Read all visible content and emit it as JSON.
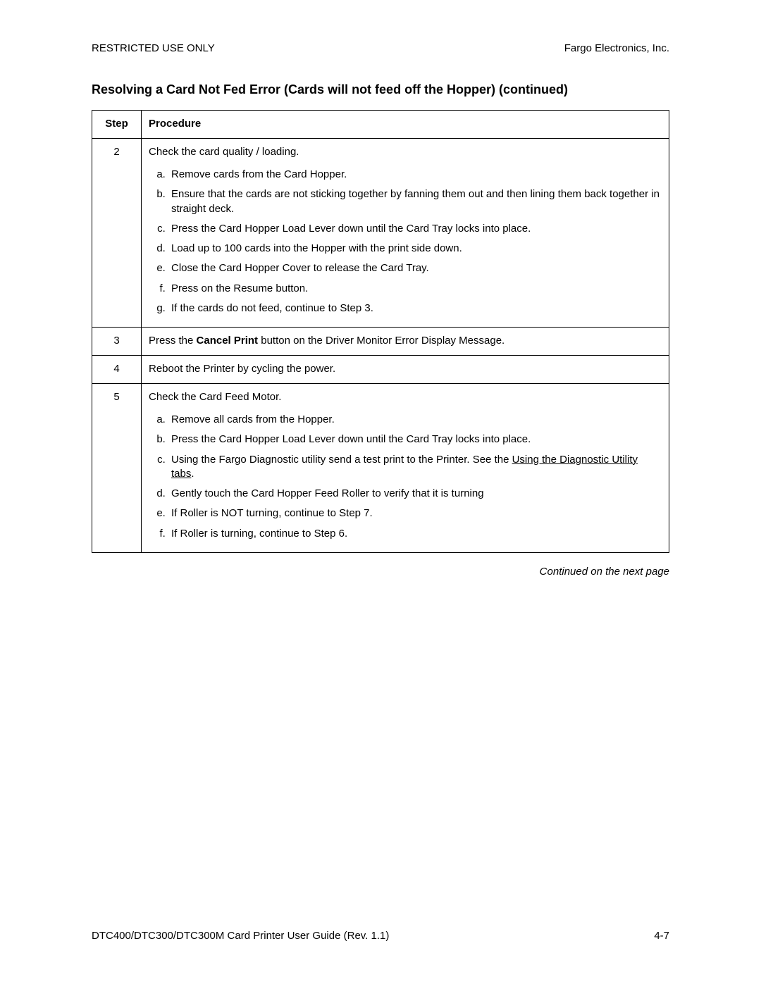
{
  "header": {
    "left": "RESTRICTED USE ONLY",
    "right": "Fargo Electronics, Inc."
  },
  "title": "Resolving a Card Not Fed Error (Cards will not feed off the Hopper) (continued)",
  "table": {
    "col_step": "Step",
    "col_proc": "Procedure",
    "rows": [
      {
        "step": "2",
        "intro": "Check the card quality / loading.",
        "items": [
          "Remove cards from the Card Hopper.",
          "Ensure that the cards are not sticking together by fanning them out and then lining them back together in straight deck.",
          "Press the Card Hopper Load Lever down until the Card Tray locks into place.",
          "Load up to 100 cards into the Hopper with the print side down.",
          "Close the Card Hopper Cover to release the Card Tray.",
          "Press on the Resume button.",
          "If the cards do not feed, continue to Step 3."
        ]
      },
      {
        "step": "3",
        "intro_pre": "Press the ",
        "intro_bold": "Cancel Print",
        "intro_post": " button on the Driver Monitor Error Display Message."
      },
      {
        "step": "4",
        "intro": "Reboot the Printer by cycling the power."
      },
      {
        "step": "5",
        "intro": "Check the Card Feed Motor.",
        "items": [
          "Remove all cards from the Hopper.",
          "Press the Card Hopper Load Lever down until the Card Tray locks into place.",
          {
            "pre": "Using the Fargo Diagnostic utility send a test print to the Printer. See the ",
            "link": "Using the Diagnostic Utility tabs",
            "post": "."
          },
          "Gently touch the Card Hopper Feed Roller to verify that it is turning",
          "If Roller is NOT turning, continue to Step 7.",
          "If Roller is turning, continue to Step 6."
        ]
      }
    ]
  },
  "continued": "Continued on the next page",
  "footer": {
    "left": "DTC400/DTC300/DTC300M Card Printer User Guide (Rev. 1.1)",
    "right": "4-7"
  }
}
